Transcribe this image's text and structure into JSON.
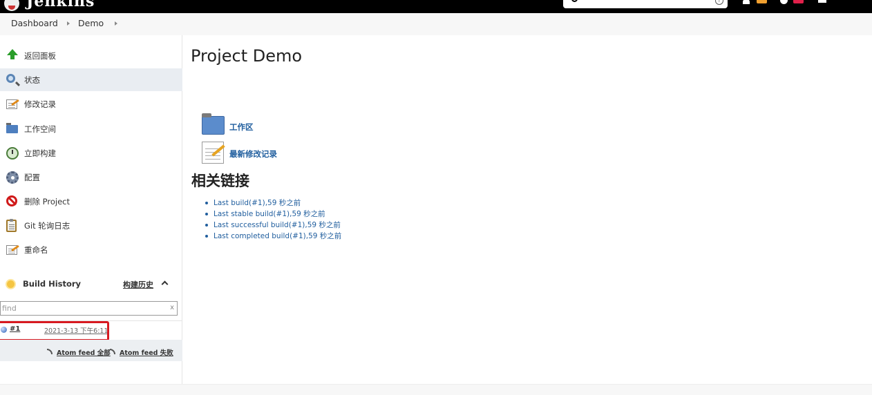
{
  "header": {
    "app_name": "Jenkins",
    "search": {
      "placeholder": ""
    }
  },
  "breadcrumbs": [
    "Dashboard",
    "Demo"
  ],
  "sidebar": {
    "items": [
      {
        "label": "返回面板",
        "icon": "arrow-up-icon"
      },
      {
        "label": "状态",
        "icon": "magnifier-icon",
        "active": true
      },
      {
        "label": "修改记录",
        "icon": "notepad-icon"
      },
      {
        "label": "工作空间",
        "icon": "folder-icon"
      },
      {
        "label": "立即构建",
        "icon": "clock-icon"
      },
      {
        "label": "配置",
        "icon": "gear-icon"
      },
      {
        "label": "删除 Project",
        "icon": "no-entry-icon"
      },
      {
        "label": "Git 轮询日志",
        "icon": "clipboard-icon"
      },
      {
        "label": "重命名",
        "icon": "notepad-icon"
      }
    ]
  },
  "build_history": {
    "title": "Build History",
    "trend_label": "构建历史",
    "find_placeholder": "find",
    "find_clear": "x",
    "builds": [
      {
        "number": "#1",
        "time": "2021-3-13 下午6:11"
      }
    ],
    "feeds": {
      "all": "Atom feed 全部",
      "failures": "Atom feed 失败"
    }
  },
  "main": {
    "title": "Project Demo",
    "workspace_link": "工作区",
    "changes_link": "最新修改记录",
    "related_title": "相关链接",
    "related_links": [
      "Last build(#1),59 秒之前",
      "Last stable build(#1),59 秒之前",
      "Last successful build(#1),59 秒之前",
      "Last completed build(#1),59 秒之前"
    ]
  },
  "colors": {
    "link": "#205e9e",
    "highlight": "#d71920",
    "topbar": "#000000"
  }
}
